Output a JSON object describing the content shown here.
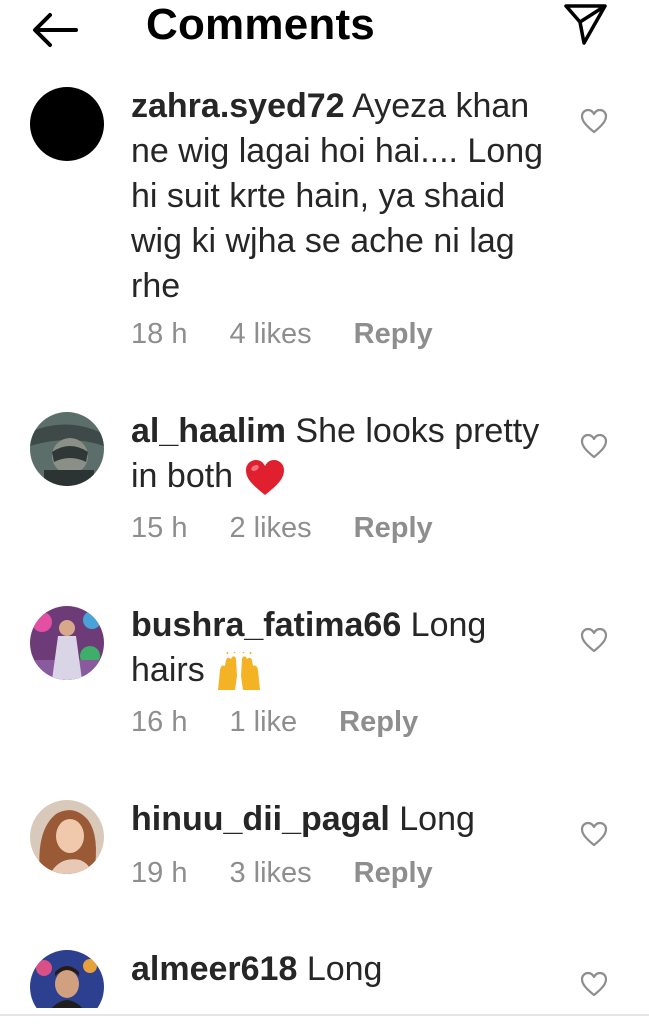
{
  "header": {
    "title": "Comments",
    "back_icon": "arrow-left-icon",
    "send_icon": "paper-plane-icon"
  },
  "comments": [
    {
      "username": "zahra.syed72",
      "text": " Ayeza khan ne wig lagai hoi hai.... Long hi suit krte hain, ya shaid wig ki wjha se ache ni lag rhe",
      "time": "18 h",
      "likes": "4 likes",
      "reply": "Reply"
    },
    {
      "username": "al_haalim",
      "text": " She looks pretty in both",
      "emoji": "red-heart",
      "time": "15 h",
      "likes": "2 likes",
      "reply": "Reply"
    },
    {
      "username": "bushra_fatima66",
      "text": " Long hairs",
      "emoji": "raising-hands",
      "time": "16 h",
      "likes": "1 like",
      "reply": "Reply"
    },
    {
      "username": "hinuu_dii_pagal",
      "text": " Long",
      "time": "19 h",
      "likes": "3 likes",
      "reply": "Reply"
    },
    {
      "username": "almeer618",
      "text": " Long"
    }
  ],
  "colors": {
    "text": "#262626",
    "meta": "#8e8e8e",
    "heart_emoji": "#e0202f"
  }
}
